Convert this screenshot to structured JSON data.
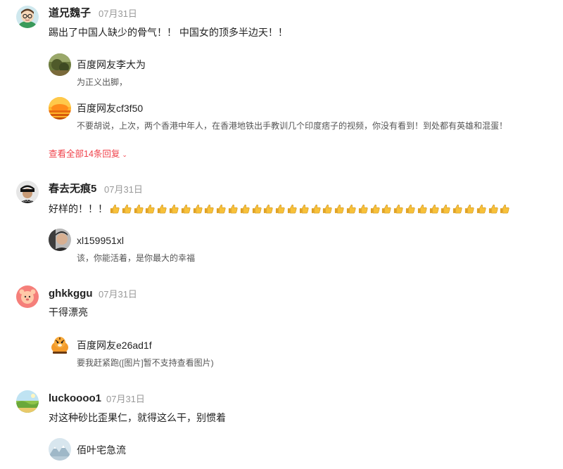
{
  "comments": [
    {
      "user": "道兄魏子",
      "date": "07月31日",
      "text": "踢出了中国人缺少的骨气！！ 中国女的顶多半边天！！",
      "avatar_icon": "cartoon-man-glasses-avatar",
      "replies": [
        {
          "user": "百度网友李大为",
          "text": "为正义出脚，",
          "avatar_icon": "landscape-photo-avatar"
        },
        {
          "user": "百度网友cf3f50",
          "text": "不要胡说，上次，两个香港中年人，在香港地铁出手教训几个印度痞子的视频，你没有看到！到处都有英雄和混蛋！",
          "avatar_icon": "sunset-avatar"
        }
      ],
      "more_replies": "查看全部14条回复"
    },
    {
      "user": "春去无痕5",
      "date": "07月31日",
      "text": "好样的！！！",
      "emoji_name": "thumbs-up-icon",
      "emoji_count": 34,
      "avatar_icon": "man-cap-avatar",
      "replies": [
        {
          "user": "xl159951xl",
          "text": "该，你能活着，是你最大的幸福",
          "avatar_icon": "man-portrait-avatar"
        }
      ]
    },
    {
      "user": "ghkkggu",
      "date": "07月31日",
      "text": "干得漂亮",
      "avatar_icon": "pink-cartoon-avatar",
      "replies": [
        {
          "user": "百度网友e26ad1f",
          "text": "要我赶紧跑([图片]暂不支持查看图片)",
          "avatar_icon": "tiger-cartoon-avatar"
        }
      ]
    },
    {
      "user": "luckoooo1",
      "date": "07月31日",
      "text": "对这种砂比歪果仁，就得这么干，别惯着",
      "avatar_icon": "nature-avatar",
      "replies": [
        {
          "user": "佰叶宅急流",
          "text": "",
          "avatar_icon": "mountain-avatar"
        }
      ]
    }
  ]
}
